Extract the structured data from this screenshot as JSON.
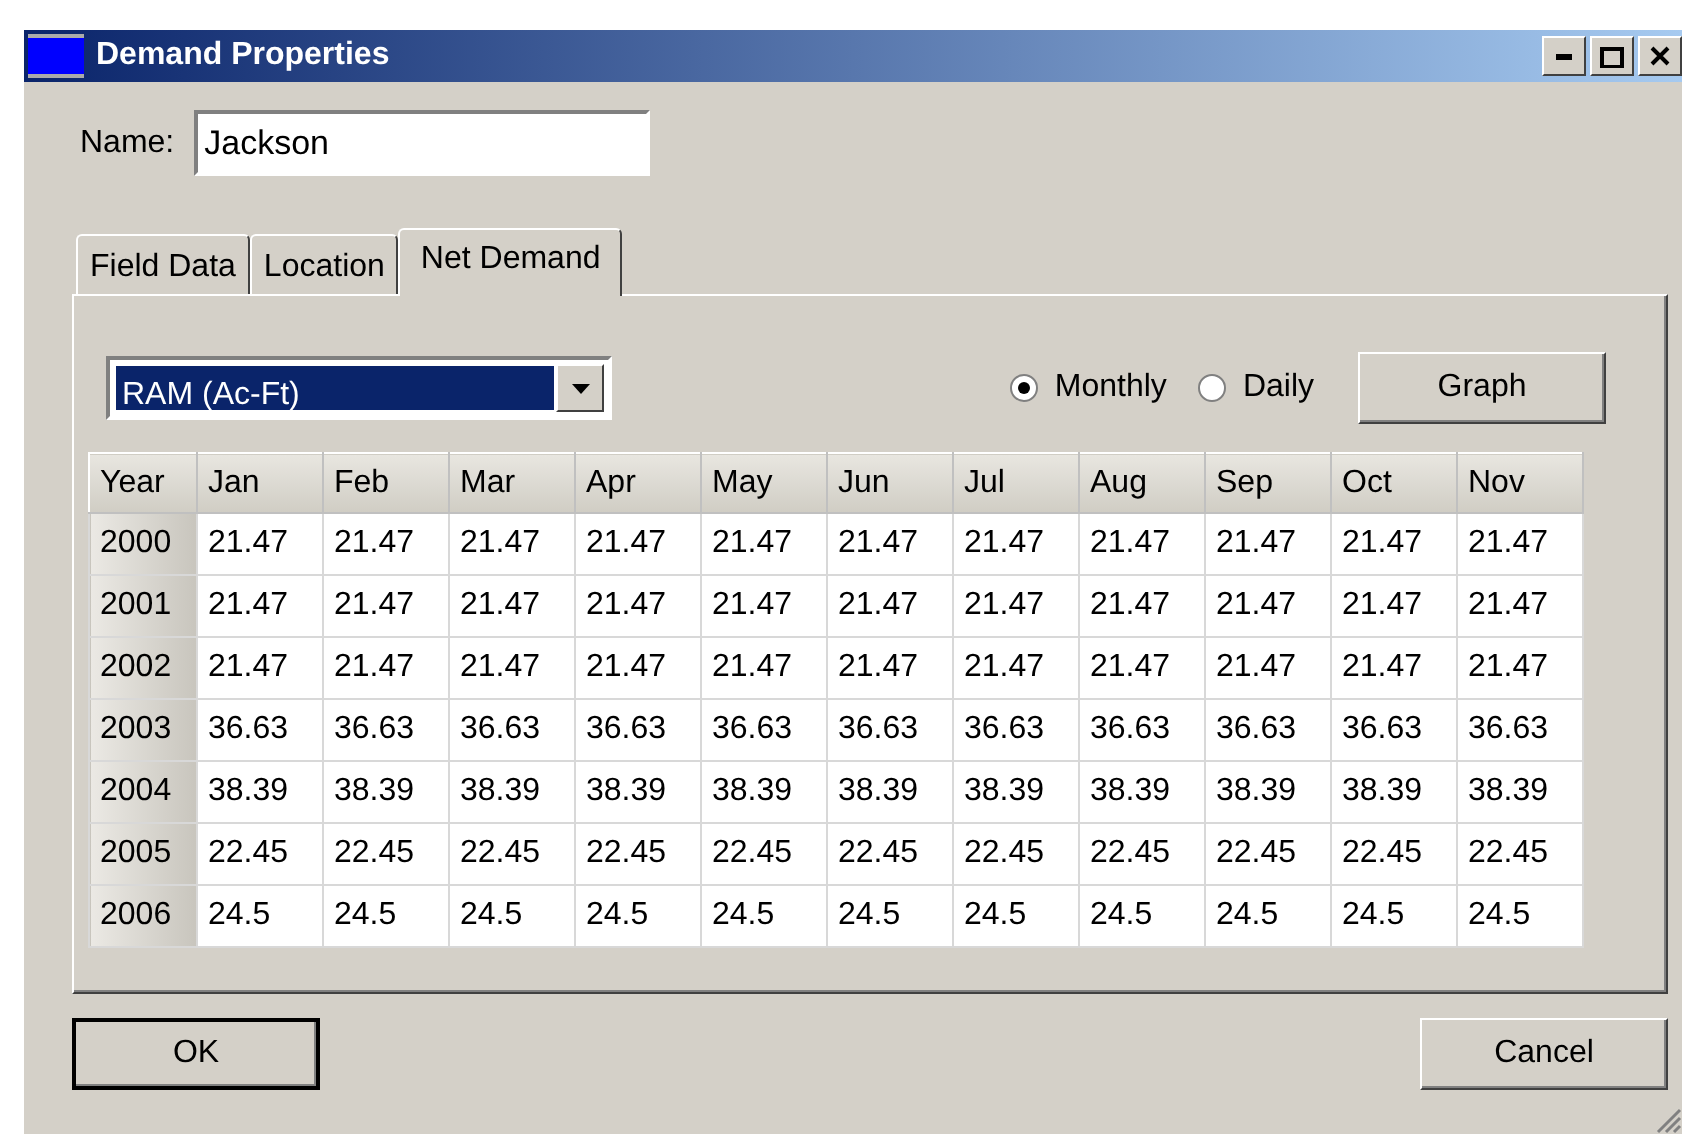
{
  "window": {
    "title": "Demand Properties"
  },
  "name_field": {
    "label": "Name:",
    "value": "Jackson"
  },
  "tabs": [
    {
      "label": "Field Data",
      "selected": false
    },
    {
      "label": "Location",
      "selected": false
    },
    {
      "label": "Net Demand",
      "selected": true
    }
  ],
  "units_dropdown": {
    "value": "RAM (Ac-Ft)"
  },
  "interval": [
    {
      "label": "Monthly",
      "selected": true
    },
    {
      "label": "Daily",
      "selected": false
    }
  ],
  "graph_button": "Graph",
  "table": {
    "columns": [
      "Year",
      "Jan",
      "Feb",
      "Mar",
      "Apr",
      "May",
      "Jun",
      "Jul",
      "Aug",
      "Sep",
      "Oct",
      "Nov"
    ],
    "rows": [
      [
        "2000",
        "21.47",
        "21.47",
        "21.47",
        "21.47",
        "21.47",
        "21.47",
        "21.47",
        "21.47",
        "21.47",
        "21.47",
        "21.47"
      ],
      [
        "2001",
        "21.47",
        "21.47",
        "21.47",
        "21.47",
        "21.47",
        "21.47",
        "21.47",
        "21.47",
        "21.47",
        "21.47",
        "21.47"
      ],
      [
        "2002",
        "21.47",
        "21.47",
        "21.47",
        "21.47",
        "21.47",
        "21.47",
        "21.47",
        "21.47",
        "21.47",
        "21.47",
        "21.47"
      ],
      [
        "2003",
        "36.63",
        "36.63",
        "36.63",
        "36.63",
        "36.63",
        "36.63",
        "36.63",
        "36.63",
        "36.63",
        "36.63",
        "36.63"
      ],
      [
        "2004",
        "38.39",
        "38.39",
        "38.39",
        "38.39",
        "38.39",
        "38.39",
        "38.39",
        "38.39",
        "38.39",
        "38.39",
        "38.39"
      ],
      [
        "2005",
        "22.45",
        "22.45",
        "22.45",
        "22.45",
        "22.45",
        "22.45",
        "22.45",
        "22.45",
        "22.45",
        "22.45",
        "22.45"
      ],
      [
        "2006",
        "24.5",
        "24.5",
        "24.5",
        "24.5",
        "24.5",
        "24.5",
        "24.5",
        "24.5",
        "24.5",
        "24.5",
        "24.5"
      ]
    ]
  },
  "buttons": [
    "OK",
    "Cancel"
  ]
}
